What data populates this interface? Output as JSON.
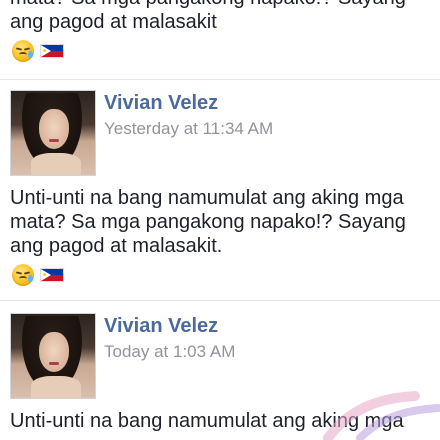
{
  "feed": {
    "top_post": {
      "text": "mata? Sa mga pangakong napako!? Sayang\nang pagod at malasakit",
      "emojis": [
        "sad-relieved-face-emoji",
        "philippines-flag-emoji"
      ]
    },
    "posts": [
      {
        "author": "Vivian Velez",
        "timestamp": "Yesterday at 11:34 AM",
        "text": "Unti-unti na bang namumulat ang aking mga\nmata? Sa mga pangakong napako!? Sayang\nang pagod at malasakit.",
        "emojis": [
          "sad-relieved-face-emoji",
          "philippines-flag-emoji"
        ]
      },
      {
        "author": "Vivian Velez",
        "timestamp": "Today at 1:03 AM",
        "text": "Unti-unti na bang namumulat ang aking mga"
      }
    ]
  },
  "colors": {
    "author_link": "#4b6a9b",
    "timestamp": "#90949c",
    "body_text": "#1d2129",
    "divider": "#e5e6e9"
  }
}
